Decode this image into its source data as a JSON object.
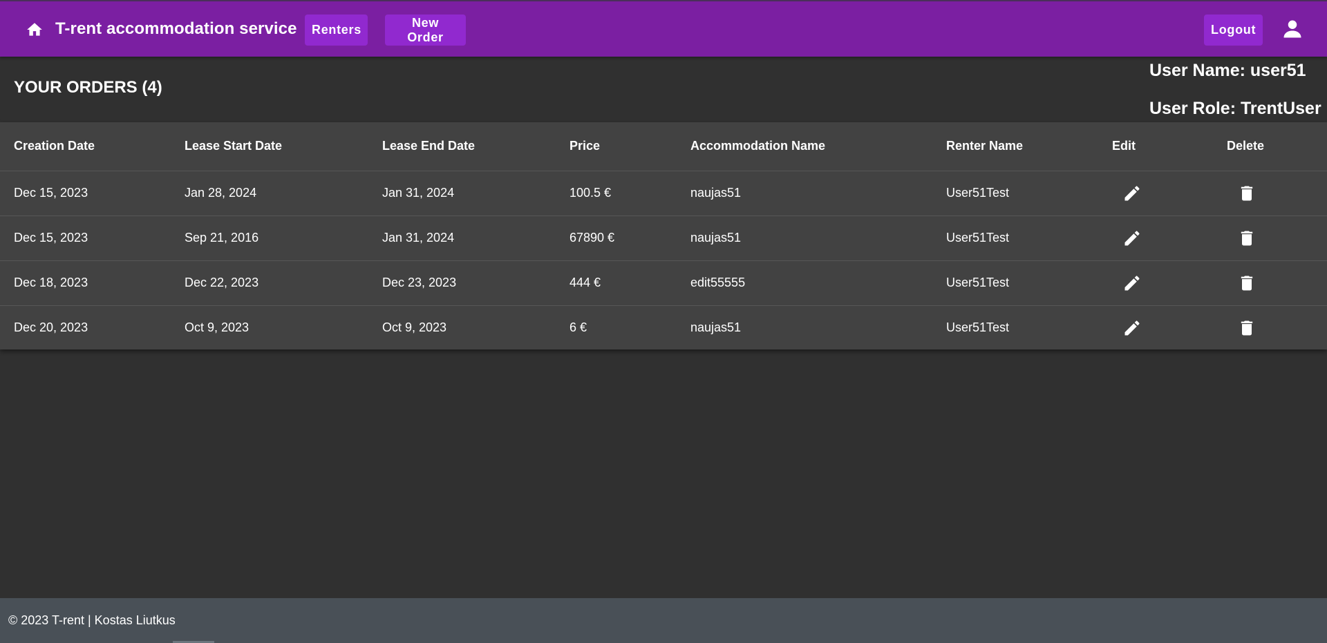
{
  "header": {
    "title": "T-rent accommodation service",
    "nav": {
      "renters": "Renters",
      "new_order": "New Order",
      "logout": "Logout"
    },
    "home_icon": "home-icon",
    "account_icon": "account-circle-icon",
    "colors": {
      "bar": "#7b1fa2",
      "button": "#9129cf"
    }
  },
  "page": {
    "title": "YOUR ORDERS (4)",
    "user_name": "User Name: user51",
    "user_role": "User Role: TrentUser"
  },
  "table": {
    "headers": [
      "Creation Date",
      "Lease Start Date",
      "Lease End Date",
      "Price",
      "Accommodation Name",
      "Renter Name",
      "Edit",
      "Delete"
    ],
    "rows": [
      {
        "creation": "Dec 15, 2023",
        "start": "Jan 28, 2024",
        "end": "Jan 31, 2024",
        "price": "100.5 €",
        "accommodation": "naujas51",
        "renter": "User51Test"
      },
      {
        "creation": "Dec 15, 2023",
        "start": "Sep 21, 2016",
        "end": "Jan 31, 2024",
        "price": "67890 €",
        "accommodation": "naujas51",
        "renter": "User51Test"
      },
      {
        "creation": "Dec 18, 2023",
        "start": "Dec 22, 2023",
        "end": "Dec 23, 2023",
        "price": "444 €",
        "accommodation": "edit55555",
        "renter": "User51Test"
      },
      {
        "creation": "Dec 20, 2023",
        "start": "Oct 9, 2023",
        "end": "Oct 9, 2023",
        "price": "6 €",
        "accommodation": "naujas51",
        "renter": "User51Test"
      }
    ],
    "edit_icon": "pencil-icon",
    "delete_icon": "trash-icon"
  },
  "footer": {
    "text": "© 2023 T-rent | Kostas Liutkus"
  }
}
